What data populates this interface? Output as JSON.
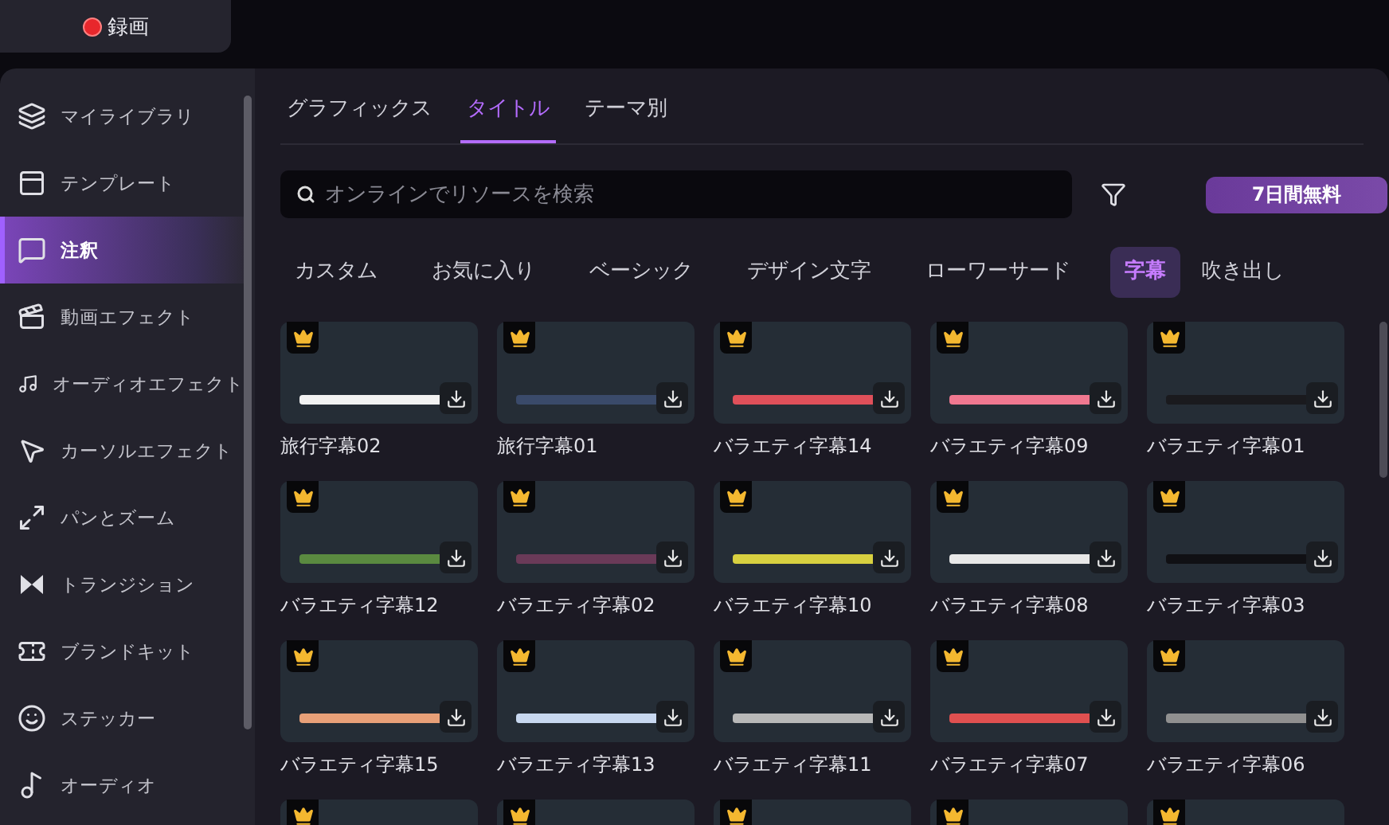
{
  "record_button": {
    "label": "録画",
    "recording": true
  },
  "sidebar": {
    "items": [
      {
        "label": "マイライブラリ",
        "selected": false
      },
      {
        "label": "テンプレート",
        "selected": false
      },
      {
        "label": "注釈",
        "selected": true
      },
      {
        "label": "動画エフェクト",
        "selected": false
      },
      {
        "label": "オーディオエフェクト",
        "selected": false
      },
      {
        "label": "カーソルエフェクト",
        "selected": false
      },
      {
        "label": "パンとズーム",
        "selected": false
      },
      {
        "label": "トランジション",
        "selected": false
      },
      {
        "label": "ブランドキット",
        "selected": false
      },
      {
        "label": "ステッカー",
        "selected": false
      },
      {
        "label": "オーディオ",
        "selected": false
      }
    ]
  },
  "tabs": [
    {
      "label": "グラフィックス",
      "selected": false
    },
    {
      "label": "タイトル",
      "selected": true
    },
    {
      "label": "テーマ別",
      "selected": false
    }
  ],
  "search": {
    "placeholder": "オンラインでリソースを検索"
  },
  "trial_button": "7日間無料",
  "categories": [
    {
      "label": "カスタム",
      "selected": false
    },
    {
      "label": "お気に入り",
      "selected": false
    },
    {
      "label": "ベーシック",
      "selected": false
    },
    {
      "label": "デザイン文字",
      "selected": false
    },
    {
      "label": "ローワーサード",
      "selected": false
    },
    {
      "label": "字幕",
      "selected": true
    },
    {
      "label": "吹き出し",
      "selected": false
    }
  ],
  "items": [
    {
      "name": "旅行字幕02",
      "premium": true,
      "color": "#f2f2f2"
    },
    {
      "name": "旅行字幕01",
      "premium": true,
      "color": "#3a4a6a"
    },
    {
      "name": "バラエティ字幕14",
      "premium": true,
      "color": "#e0505a"
    },
    {
      "name": "バラエティ字幕09",
      "premium": true,
      "color": "#f07890"
    },
    {
      "name": "バラエティ字幕01",
      "premium": true,
      "color": "#1a1a1e"
    },
    {
      "name": "バラエティ字幕12",
      "premium": true,
      "color": "#5a8a40"
    },
    {
      "name": "バラエティ字幕02",
      "premium": true,
      "color": "#6a3a58"
    },
    {
      "name": "バラエティ字幕10",
      "premium": true,
      "color": "#d8d040"
    },
    {
      "name": "バラエティ字幕08",
      "premium": true,
      "color": "#e8e8e8"
    },
    {
      "name": "バラエティ字幕03",
      "premium": true,
      "color": "#101014"
    },
    {
      "name": "バラエティ字幕15",
      "premium": true,
      "color": "#e8a078"
    },
    {
      "name": "バラエティ字幕13",
      "premium": true,
      "color": "#c8d8f0"
    },
    {
      "name": "バラエティ字幕11",
      "premium": true,
      "color": "#b8b8b8"
    },
    {
      "name": "バラエティ字幕07",
      "premium": true,
      "color": "#e05050"
    },
    {
      "name": "バラエティ字幕06",
      "premium": true,
      "color": "#909090"
    }
  ],
  "items_cut": [
    {
      "premium": true
    },
    {
      "premium": true
    },
    {
      "premium": true
    },
    {
      "premium": true
    },
    {
      "premium": true
    }
  ]
}
